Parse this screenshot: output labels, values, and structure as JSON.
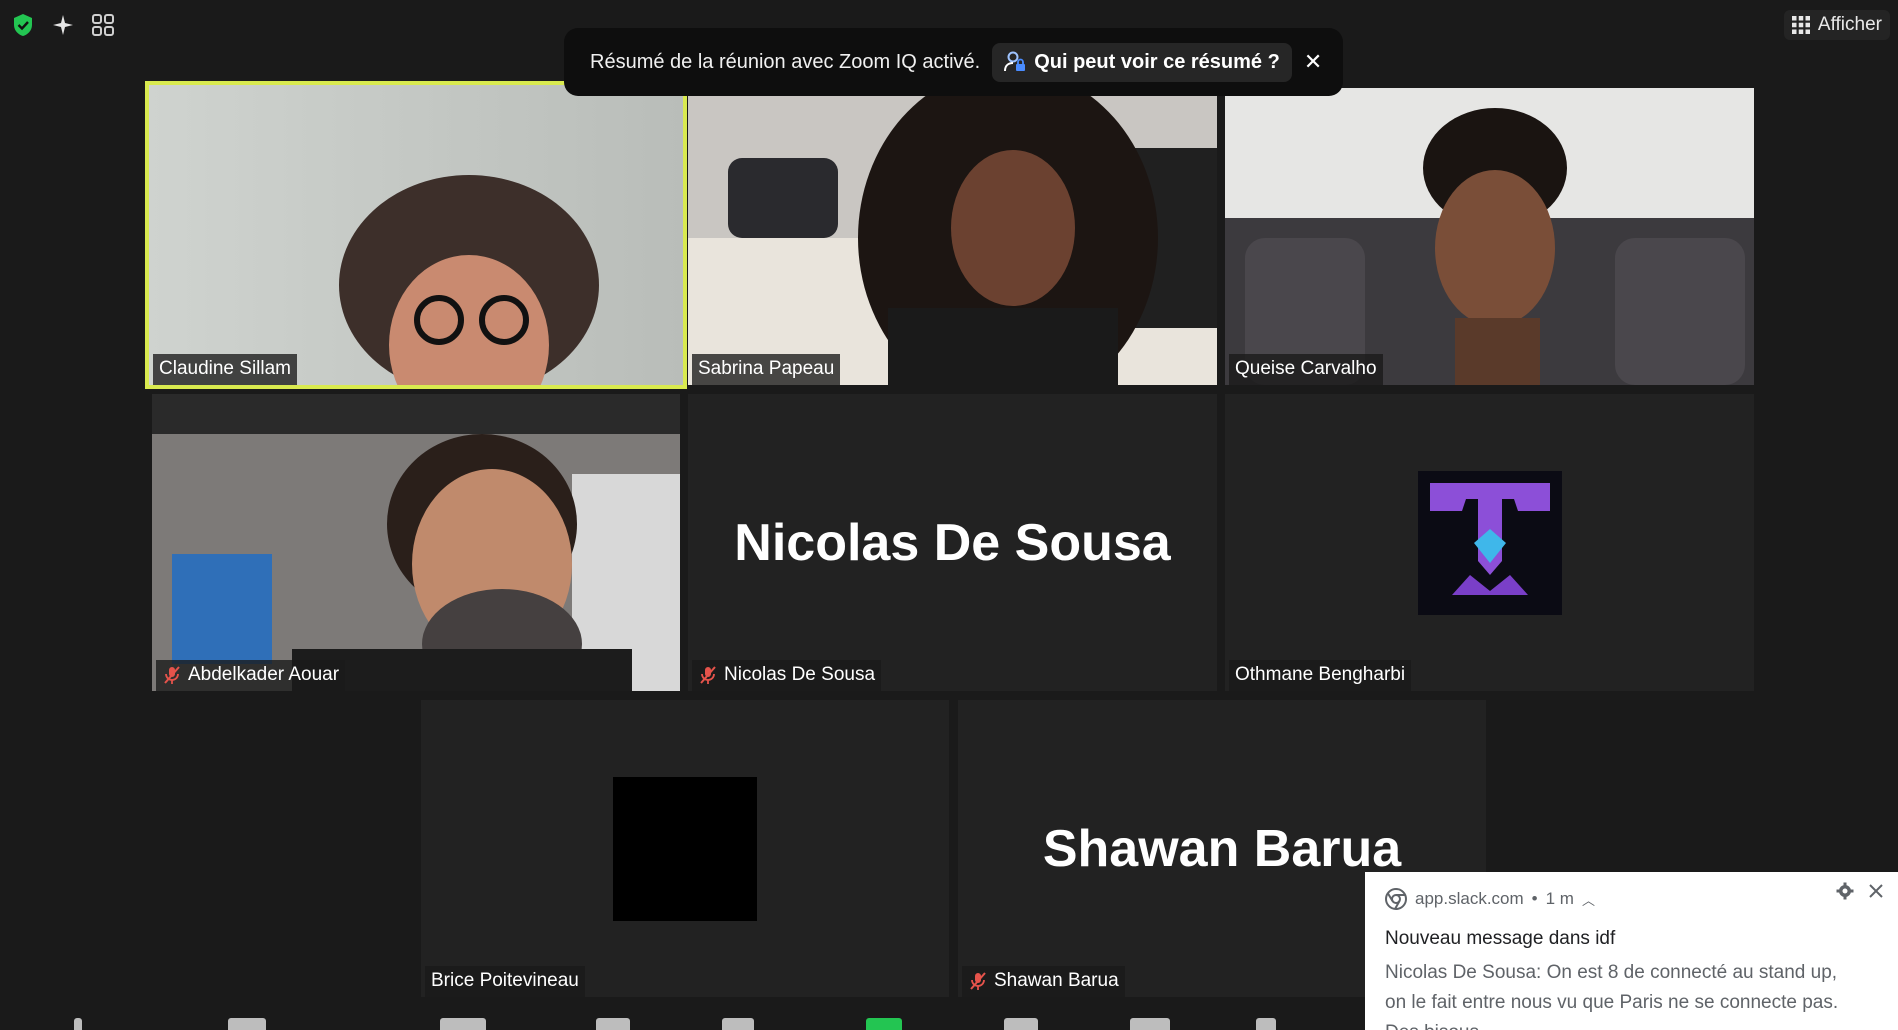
{
  "banner": {
    "text": "Résumé de la réunion avec Zoom IQ activé.",
    "button_label": "Qui peut voir ce résumé ?",
    "close_label": "✕"
  },
  "top_right": {
    "label": "Afficher"
  },
  "participants": [
    {
      "name": "Claudine Sillam",
      "muted": false,
      "speaking": true,
      "video": true
    },
    {
      "name": "Sabrina Papeau",
      "muted": false,
      "speaking": false,
      "video": true
    },
    {
      "name": "Queise Carvalho",
      "muted": false,
      "speaking": false,
      "video": true
    },
    {
      "name": "Abdelkader Aouar",
      "muted": true,
      "speaking": false,
      "video": true
    },
    {
      "name": "Nicolas De Sousa",
      "muted": true,
      "speaking": false,
      "video": false,
      "display_name": "Nicolas De Sousa"
    },
    {
      "name": "Othmane Bengharbi",
      "muted": false,
      "speaking": false,
      "video": false
    },
    {
      "name": "Brice Poitevineau",
      "muted": false,
      "speaking": false,
      "video": false
    },
    {
      "name": "Shawan Barua",
      "muted": true,
      "speaking": false,
      "video": false,
      "display_name": "Shawan Barua"
    }
  ],
  "notification": {
    "source": "app.slack.com",
    "time": "1 m",
    "title": "Nouveau message dans idf",
    "body_line1": "Nicolas De Sousa: On est 8 de connecté au stand up,",
    "body_line2": "on le fait entre nous vu que Paris ne se connecte pas.",
    "body_line3": "Des bisous"
  },
  "colors": {
    "background": "#1a1a1a",
    "tile": "#222222",
    "speaking_border": "#d9ea4f",
    "shield_green": "#23c552",
    "muted_red": "#e5534b"
  }
}
